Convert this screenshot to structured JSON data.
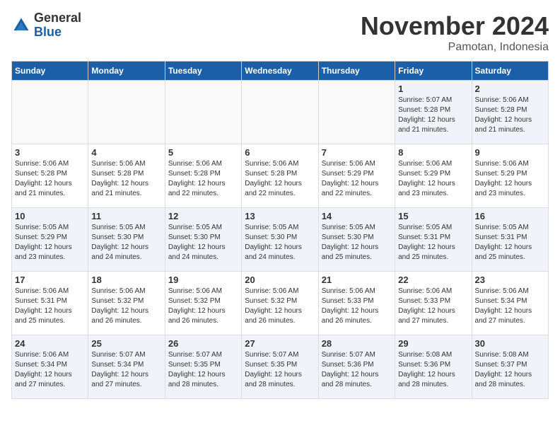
{
  "logo": {
    "general": "General",
    "blue": "Blue"
  },
  "header": {
    "month": "November 2024",
    "location": "Pamotan, Indonesia"
  },
  "weekdays": [
    "Sunday",
    "Monday",
    "Tuesday",
    "Wednesday",
    "Thursday",
    "Friday",
    "Saturday"
  ],
  "weeks": [
    [
      {
        "day": "",
        "info": "",
        "empty": true
      },
      {
        "day": "",
        "info": "",
        "empty": true
      },
      {
        "day": "",
        "info": "",
        "empty": true
      },
      {
        "day": "",
        "info": "",
        "empty": true
      },
      {
        "day": "",
        "info": "",
        "empty": true
      },
      {
        "day": "1",
        "info": "Sunrise: 5:07 AM\nSunset: 5:28 PM\nDaylight: 12 hours\nand 21 minutes."
      },
      {
        "day": "2",
        "info": "Sunrise: 5:06 AM\nSunset: 5:28 PM\nDaylight: 12 hours\nand 21 minutes."
      }
    ],
    [
      {
        "day": "3",
        "info": "Sunrise: 5:06 AM\nSunset: 5:28 PM\nDaylight: 12 hours\nand 21 minutes."
      },
      {
        "day": "4",
        "info": "Sunrise: 5:06 AM\nSunset: 5:28 PM\nDaylight: 12 hours\nand 21 minutes."
      },
      {
        "day": "5",
        "info": "Sunrise: 5:06 AM\nSunset: 5:28 PM\nDaylight: 12 hours\nand 22 minutes."
      },
      {
        "day": "6",
        "info": "Sunrise: 5:06 AM\nSunset: 5:28 PM\nDaylight: 12 hours\nand 22 minutes."
      },
      {
        "day": "7",
        "info": "Sunrise: 5:06 AM\nSunset: 5:29 PM\nDaylight: 12 hours\nand 22 minutes."
      },
      {
        "day": "8",
        "info": "Sunrise: 5:06 AM\nSunset: 5:29 PM\nDaylight: 12 hours\nand 23 minutes."
      },
      {
        "day": "9",
        "info": "Sunrise: 5:06 AM\nSunset: 5:29 PM\nDaylight: 12 hours\nand 23 minutes."
      }
    ],
    [
      {
        "day": "10",
        "info": "Sunrise: 5:05 AM\nSunset: 5:29 PM\nDaylight: 12 hours\nand 23 minutes."
      },
      {
        "day": "11",
        "info": "Sunrise: 5:05 AM\nSunset: 5:30 PM\nDaylight: 12 hours\nand 24 minutes."
      },
      {
        "day": "12",
        "info": "Sunrise: 5:05 AM\nSunset: 5:30 PM\nDaylight: 12 hours\nand 24 minutes."
      },
      {
        "day": "13",
        "info": "Sunrise: 5:05 AM\nSunset: 5:30 PM\nDaylight: 12 hours\nand 24 minutes."
      },
      {
        "day": "14",
        "info": "Sunrise: 5:05 AM\nSunset: 5:30 PM\nDaylight: 12 hours\nand 25 minutes."
      },
      {
        "day": "15",
        "info": "Sunrise: 5:05 AM\nSunset: 5:31 PM\nDaylight: 12 hours\nand 25 minutes."
      },
      {
        "day": "16",
        "info": "Sunrise: 5:05 AM\nSunset: 5:31 PM\nDaylight: 12 hours\nand 25 minutes."
      }
    ],
    [
      {
        "day": "17",
        "info": "Sunrise: 5:06 AM\nSunset: 5:31 PM\nDaylight: 12 hours\nand 25 minutes."
      },
      {
        "day": "18",
        "info": "Sunrise: 5:06 AM\nSunset: 5:32 PM\nDaylight: 12 hours\nand 26 minutes."
      },
      {
        "day": "19",
        "info": "Sunrise: 5:06 AM\nSunset: 5:32 PM\nDaylight: 12 hours\nand 26 minutes."
      },
      {
        "day": "20",
        "info": "Sunrise: 5:06 AM\nSunset: 5:32 PM\nDaylight: 12 hours\nand 26 minutes."
      },
      {
        "day": "21",
        "info": "Sunrise: 5:06 AM\nSunset: 5:33 PM\nDaylight: 12 hours\nand 26 minutes."
      },
      {
        "day": "22",
        "info": "Sunrise: 5:06 AM\nSunset: 5:33 PM\nDaylight: 12 hours\nand 27 minutes."
      },
      {
        "day": "23",
        "info": "Sunrise: 5:06 AM\nSunset: 5:34 PM\nDaylight: 12 hours\nand 27 minutes."
      }
    ],
    [
      {
        "day": "24",
        "info": "Sunrise: 5:06 AM\nSunset: 5:34 PM\nDaylight: 12 hours\nand 27 minutes."
      },
      {
        "day": "25",
        "info": "Sunrise: 5:07 AM\nSunset: 5:34 PM\nDaylight: 12 hours\nand 27 minutes."
      },
      {
        "day": "26",
        "info": "Sunrise: 5:07 AM\nSunset: 5:35 PM\nDaylight: 12 hours\nand 28 minutes."
      },
      {
        "day": "27",
        "info": "Sunrise: 5:07 AM\nSunset: 5:35 PM\nDaylight: 12 hours\nand 28 minutes."
      },
      {
        "day": "28",
        "info": "Sunrise: 5:07 AM\nSunset: 5:36 PM\nDaylight: 12 hours\nand 28 minutes."
      },
      {
        "day": "29",
        "info": "Sunrise: 5:08 AM\nSunset: 5:36 PM\nDaylight: 12 hours\nand 28 minutes."
      },
      {
        "day": "30",
        "info": "Sunrise: 5:08 AM\nSunset: 5:37 PM\nDaylight: 12 hours\nand 28 minutes."
      }
    ]
  ]
}
